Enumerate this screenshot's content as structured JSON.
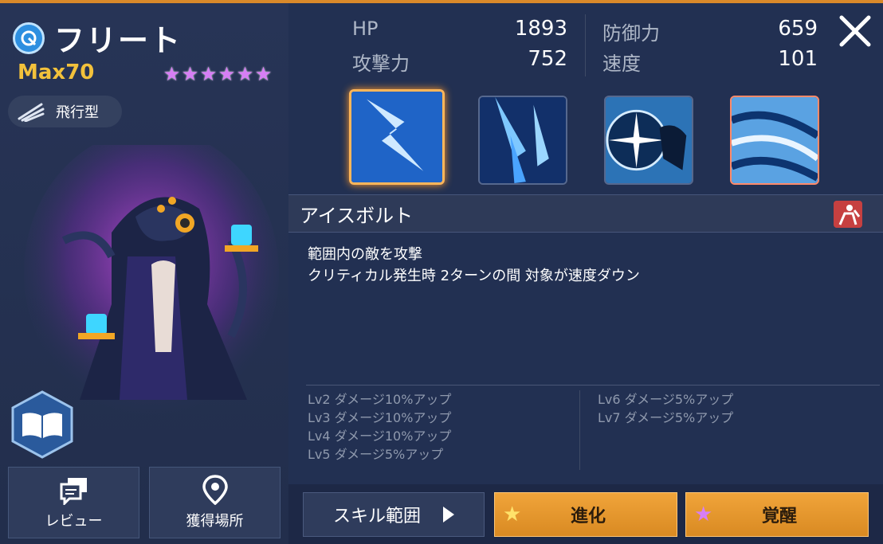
{
  "character": {
    "name": "フリート",
    "max_level": "Max70",
    "stars": 6,
    "type": "飛行型"
  },
  "actions_left": {
    "review": "レビュー",
    "acquisition": "獲得場所"
  },
  "stats": {
    "hp_label": "HP",
    "hp_value": "1893",
    "defense_label": "防御力",
    "defense_value": "659",
    "attack_label": "攻撃力",
    "attack_value": "752",
    "speed_label": "速度",
    "speed_value": "101"
  },
  "skill": {
    "selected_index": 0,
    "title": "アイスボルト",
    "description": [
      "範囲内の敵を攻撃",
      "クリティカル発生時 2ターンの間 対象が速度ダウン"
    ],
    "levels_left": [
      "Lv2 ダメージ10%アップ",
      "Lv3 ダメージ10%アップ",
      "Lv4 ダメージ10%アップ",
      "Lv5 ダメージ5%アップ"
    ],
    "levels_right": [
      "Lv6 ダメージ5%アップ",
      "Lv7 ダメージ5%アップ"
    ]
  },
  "bottom": {
    "skill_range": "スキル範囲",
    "evolve": "進化",
    "awaken": "覚醒"
  },
  "colors": {
    "accent_orange": "#e69a30",
    "star_purple": "#d77ef5",
    "level_yellow": "#f2c13b"
  }
}
